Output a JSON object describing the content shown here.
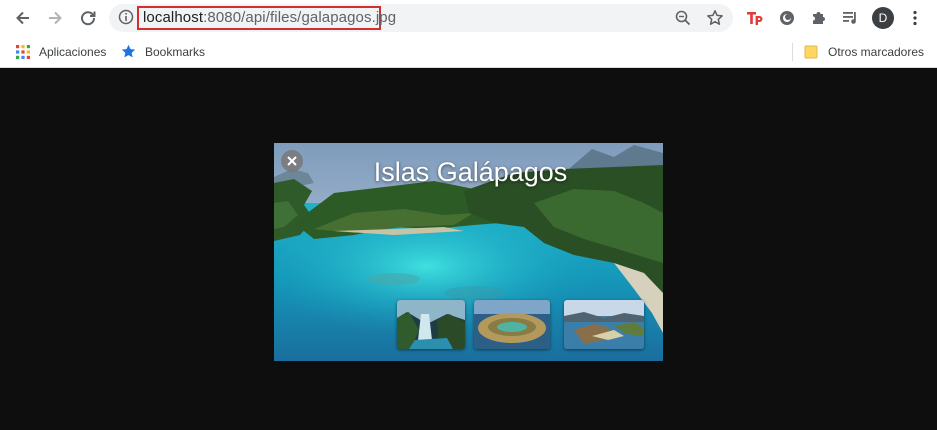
{
  "browser": {
    "url_host": "localhost",
    "url_path": ":8080/api/files/galapagos.jpg",
    "avatar_letter": "D"
  },
  "bookmarks": {
    "apps_label": "Aplicaciones",
    "bookmarks_label": "Bookmarks",
    "other_label": "Otros marcadores"
  },
  "image": {
    "title": "Islas Galápagos"
  },
  "colors": {
    "highlight": "#d32f2f",
    "page_background": "#0e0e0e",
    "avatar_bg": "#3c4043"
  }
}
